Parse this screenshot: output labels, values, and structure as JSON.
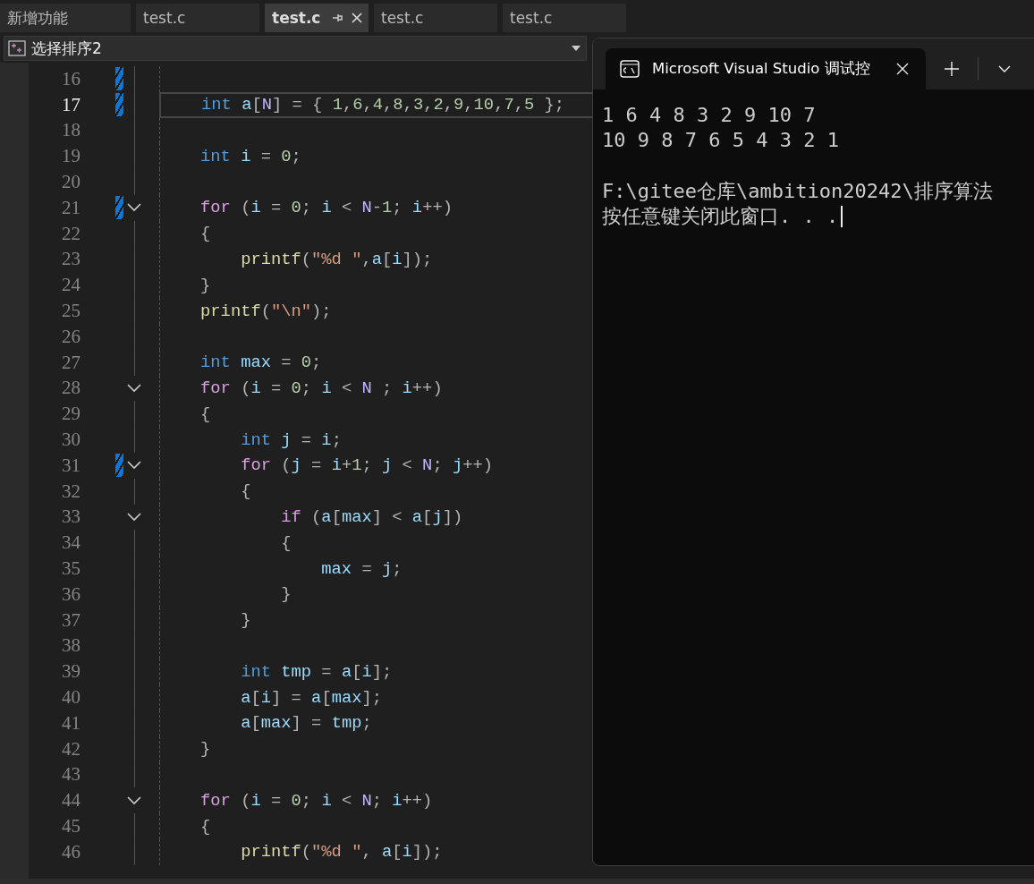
{
  "editor_tabs": [
    {
      "label": "新增功能",
      "selected": false,
      "pinnable": false
    },
    {
      "label": "test.c",
      "selected": false,
      "pinnable": false
    },
    {
      "label": "test.c",
      "selected": true,
      "pinnable": true
    },
    {
      "label": "test.c",
      "selected": false,
      "pinnable": false
    },
    {
      "label": "test.c",
      "selected": false,
      "pinnable": false
    }
  ],
  "navigation_bar": {
    "scope": "选择排序2"
  },
  "code_lines": [
    {
      "number": "16",
      "modified": true,
      "foldable": false,
      "current": false
    },
    {
      "number": "17",
      "modified": true,
      "foldable": false,
      "current": true,
      "tokens": [
        {
          "kind": "type",
          "text": "    int"
        },
        {
          "kind": "variable",
          "text": " a"
        },
        {
          "kind": "punct",
          "text": "["
        },
        {
          "kind": "macro",
          "text": "N"
        },
        {
          "kind": "punct",
          "text": "] = { "
        },
        {
          "kind": "number",
          "text": "1"
        },
        {
          "kind": "punct",
          "text": ","
        },
        {
          "kind": "number",
          "text": "6"
        },
        {
          "kind": "punct",
          "text": ","
        },
        {
          "kind": "number",
          "text": "4"
        },
        {
          "kind": "punct",
          "text": ","
        },
        {
          "kind": "number",
          "text": "8"
        },
        {
          "kind": "punct",
          "text": ","
        },
        {
          "kind": "number",
          "text": "3"
        },
        {
          "kind": "punct",
          "text": ","
        },
        {
          "kind": "number",
          "text": "2"
        },
        {
          "kind": "punct",
          "text": ","
        },
        {
          "kind": "number",
          "text": "9"
        },
        {
          "kind": "punct",
          "text": ","
        },
        {
          "kind": "number",
          "text": "10"
        },
        {
          "kind": "punct",
          "text": ","
        },
        {
          "kind": "number",
          "text": "7"
        },
        {
          "kind": "punct",
          "text": ","
        },
        {
          "kind": "number",
          "text": "5"
        },
        {
          "kind": "punct",
          "text": " };"
        }
      ]
    },
    {
      "number": "18",
      "modified": false,
      "foldable": false,
      "current": false
    },
    {
      "number": "19",
      "modified": false,
      "foldable": false,
      "current": false,
      "tokens": [
        {
          "kind": "type",
          "text": "    int"
        },
        {
          "kind": "variable",
          "text": " i"
        },
        {
          "kind": "punct",
          "text": " = "
        },
        {
          "kind": "number",
          "text": "0"
        },
        {
          "kind": "punct",
          "text": ";"
        }
      ]
    },
    {
      "number": "20",
      "modified": false,
      "foldable": false,
      "current": false
    },
    {
      "number": "21",
      "modified": true,
      "foldable": true,
      "current": false,
      "tokens": [
        {
          "kind": "keyword",
          "text": "    for"
        },
        {
          "kind": "punct",
          "text": " ("
        },
        {
          "kind": "variable",
          "text": "i"
        },
        {
          "kind": "punct",
          "text": " = "
        },
        {
          "kind": "number",
          "text": "0"
        },
        {
          "kind": "punct",
          "text": "; "
        },
        {
          "kind": "variable",
          "text": "i"
        },
        {
          "kind": "punct",
          "text": " < "
        },
        {
          "kind": "macro",
          "text": "N"
        },
        {
          "kind": "punct",
          "text": "-"
        },
        {
          "kind": "number",
          "text": "1"
        },
        {
          "kind": "punct",
          "text": "; "
        },
        {
          "kind": "variable",
          "text": "i"
        },
        {
          "kind": "punct",
          "text": "++)"
        }
      ]
    },
    {
      "number": "22",
      "modified": false,
      "foldable": false,
      "current": false,
      "tokens": [
        {
          "kind": "punct",
          "text": "    {"
        }
      ]
    },
    {
      "number": "23",
      "modified": false,
      "foldable": false,
      "current": false,
      "tokens": [
        {
          "kind": "function",
          "text": "        printf"
        },
        {
          "kind": "punct",
          "text": "("
        },
        {
          "kind": "string",
          "text": "\"%d \""
        },
        {
          "kind": "punct",
          "text": ","
        },
        {
          "kind": "variable",
          "text": "a"
        },
        {
          "kind": "punct",
          "text": "["
        },
        {
          "kind": "variable",
          "text": "i"
        },
        {
          "kind": "punct",
          "text": "]);"
        }
      ]
    },
    {
      "number": "24",
      "modified": false,
      "foldable": false,
      "current": false,
      "tokens": [
        {
          "kind": "punct",
          "text": "    }"
        }
      ]
    },
    {
      "number": "25",
      "modified": false,
      "foldable": false,
      "current": false,
      "tokens": [
        {
          "kind": "function",
          "text": "    printf"
        },
        {
          "kind": "punct",
          "text": "("
        },
        {
          "kind": "string",
          "text": "\"\\n\""
        },
        {
          "kind": "punct",
          "text": ");"
        }
      ]
    },
    {
      "number": "26",
      "modified": false,
      "foldable": false,
      "current": false
    },
    {
      "number": "27",
      "modified": false,
      "foldable": false,
      "current": false,
      "tokens": [
        {
          "kind": "type",
          "text": "    int"
        },
        {
          "kind": "variable",
          "text": " max"
        },
        {
          "kind": "punct",
          "text": " = "
        },
        {
          "kind": "number",
          "text": "0"
        },
        {
          "kind": "punct",
          "text": ";"
        }
      ]
    },
    {
      "number": "28",
      "modified": false,
      "foldable": true,
      "current": false,
      "tokens": [
        {
          "kind": "keyword",
          "text": "    for"
        },
        {
          "kind": "punct",
          "text": " ("
        },
        {
          "kind": "variable",
          "text": "i"
        },
        {
          "kind": "punct",
          "text": " = "
        },
        {
          "kind": "number",
          "text": "0"
        },
        {
          "kind": "punct",
          "text": "; "
        },
        {
          "kind": "variable",
          "text": "i"
        },
        {
          "kind": "punct",
          "text": " < "
        },
        {
          "kind": "macro",
          "text": "N"
        },
        {
          "kind": "punct",
          "text": " ; "
        },
        {
          "kind": "variable",
          "text": "i"
        },
        {
          "kind": "punct",
          "text": "++)"
        }
      ]
    },
    {
      "number": "29",
      "modified": false,
      "foldable": false,
      "current": false,
      "tokens": [
        {
          "kind": "punct",
          "text": "    {"
        }
      ]
    },
    {
      "number": "30",
      "modified": false,
      "foldable": false,
      "current": false,
      "tokens": [
        {
          "kind": "type",
          "text": "        int"
        },
        {
          "kind": "variable",
          "text": " j"
        },
        {
          "kind": "punct",
          "text": " = "
        },
        {
          "kind": "variable",
          "text": "i"
        },
        {
          "kind": "punct",
          "text": ";"
        }
      ]
    },
    {
      "number": "31",
      "modified": true,
      "foldable": true,
      "current": false,
      "tokens": [
        {
          "kind": "keyword",
          "text": "        for"
        },
        {
          "kind": "punct",
          "text": " ("
        },
        {
          "kind": "variable",
          "text": "j"
        },
        {
          "kind": "punct",
          "text": " = "
        },
        {
          "kind": "variable",
          "text": "i"
        },
        {
          "kind": "punct",
          "text": "+"
        },
        {
          "kind": "number",
          "text": "1"
        },
        {
          "kind": "punct",
          "text": "; "
        },
        {
          "kind": "variable",
          "text": "j"
        },
        {
          "kind": "punct",
          "text": " < "
        },
        {
          "kind": "macro",
          "text": "N"
        },
        {
          "kind": "punct",
          "text": "; "
        },
        {
          "kind": "variable",
          "text": "j"
        },
        {
          "kind": "punct",
          "text": "++)"
        }
      ]
    },
    {
      "number": "32",
      "modified": false,
      "foldable": false,
      "current": false,
      "tokens": [
        {
          "kind": "punct",
          "text": "        {"
        }
      ]
    },
    {
      "number": "33",
      "modified": false,
      "foldable": true,
      "current": false,
      "tokens": [
        {
          "kind": "keyword",
          "text": "            if"
        },
        {
          "kind": "punct",
          "text": " ("
        },
        {
          "kind": "variable",
          "text": "a"
        },
        {
          "kind": "punct",
          "text": "["
        },
        {
          "kind": "variable",
          "text": "max"
        },
        {
          "kind": "punct",
          "text": "] < "
        },
        {
          "kind": "variable",
          "text": "a"
        },
        {
          "kind": "punct",
          "text": "["
        },
        {
          "kind": "variable",
          "text": "j"
        },
        {
          "kind": "punct",
          "text": "])"
        }
      ]
    },
    {
      "number": "34",
      "modified": false,
      "foldable": false,
      "current": false,
      "tokens": [
        {
          "kind": "punct",
          "text": "            {"
        }
      ]
    },
    {
      "number": "35",
      "modified": false,
      "foldable": false,
      "current": false,
      "tokens": [
        {
          "kind": "variable",
          "text": "                max"
        },
        {
          "kind": "punct",
          "text": " = "
        },
        {
          "kind": "variable",
          "text": "j"
        },
        {
          "kind": "punct",
          "text": ";"
        }
      ]
    },
    {
      "number": "36",
      "modified": false,
      "foldable": false,
      "current": false,
      "tokens": [
        {
          "kind": "punct",
          "text": "            }"
        }
      ]
    },
    {
      "number": "37",
      "modified": false,
      "foldable": false,
      "current": false,
      "tokens": [
        {
          "kind": "punct",
          "text": "        }"
        }
      ]
    },
    {
      "number": "38",
      "modified": false,
      "foldable": false,
      "current": false
    },
    {
      "number": "39",
      "modified": false,
      "foldable": false,
      "current": false,
      "tokens": [
        {
          "kind": "type",
          "text": "        int"
        },
        {
          "kind": "variable",
          "text": " tmp"
        },
        {
          "kind": "punct",
          "text": " = "
        },
        {
          "kind": "variable",
          "text": "a"
        },
        {
          "kind": "punct",
          "text": "["
        },
        {
          "kind": "variable",
          "text": "i"
        },
        {
          "kind": "punct",
          "text": "];"
        }
      ]
    },
    {
      "number": "40",
      "modified": false,
      "foldable": false,
      "current": false,
      "tokens": [
        {
          "kind": "variable",
          "text": "        a"
        },
        {
          "kind": "punct",
          "text": "["
        },
        {
          "kind": "variable",
          "text": "i"
        },
        {
          "kind": "punct",
          "text": "] = "
        },
        {
          "kind": "variable",
          "text": "a"
        },
        {
          "kind": "punct",
          "text": "["
        },
        {
          "kind": "variable",
          "text": "max"
        },
        {
          "kind": "punct",
          "text": "];"
        }
      ]
    },
    {
      "number": "41",
      "modified": false,
      "foldable": false,
      "current": false,
      "tokens": [
        {
          "kind": "variable",
          "text": "        a"
        },
        {
          "kind": "punct",
          "text": "["
        },
        {
          "kind": "variable",
          "text": "max"
        },
        {
          "kind": "punct",
          "text": "] = "
        },
        {
          "kind": "variable",
          "text": "tmp"
        },
        {
          "kind": "punct",
          "text": ";"
        }
      ]
    },
    {
      "number": "42",
      "modified": false,
      "foldable": false,
      "current": false,
      "tokens": [
        {
          "kind": "punct",
          "text": "    }"
        }
      ]
    },
    {
      "number": "43",
      "modified": false,
      "foldable": false,
      "current": false
    },
    {
      "number": "44",
      "modified": false,
      "foldable": true,
      "current": false,
      "tokens": [
        {
          "kind": "keyword",
          "text": "    for"
        },
        {
          "kind": "punct",
          "text": " ("
        },
        {
          "kind": "variable",
          "text": "i"
        },
        {
          "kind": "punct",
          "text": " = "
        },
        {
          "kind": "number",
          "text": "0"
        },
        {
          "kind": "punct",
          "text": "; "
        },
        {
          "kind": "variable",
          "text": "i"
        },
        {
          "kind": "punct",
          "text": " < "
        },
        {
          "kind": "macro",
          "text": "N"
        },
        {
          "kind": "punct",
          "text": "; "
        },
        {
          "kind": "variable",
          "text": "i"
        },
        {
          "kind": "punct",
          "text": "++)"
        }
      ]
    },
    {
      "number": "45",
      "modified": false,
      "foldable": false,
      "current": false,
      "tokens": [
        {
          "kind": "punct",
          "text": "    {"
        }
      ]
    },
    {
      "number": "46",
      "modified": false,
      "foldable": false,
      "current": false,
      "tokens": [
        {
          "kind": "function",
          "text": "        printf"
        },
        {
          "kind": "punct",
          "text": "("
        },
        {
          "kind": "string",
          "text": "\"%d \""
        },
        {
          "kind": "punct",
          "text": ", "
        },
        {
          "kind": "variable",
          "text": "a"
        },
        {
          "kind": "punct",
          "text": "["
        },
        {
          "kind": "variable",
          "text": "i"
        },
        {
          "kind": "punct",
          "text": "]);"
        }
      ]
    }
  ],
  "console_window": {
    "tab_title": "Microsoft Visual Studio 调试控",
    "output_blocks": [
      {
        "lines": [
          {
            "text": "1 6 4 8 3 2 9 10 7",
            "cursor": false
          },
          {
            "text": "10 9 8 7 6 5 4 3 2 1",
            "cursor": false
          }
        ]
      },
      {
        "lines": [
          {
            "text": "F:\\gitee仓库\\ambition20242\\排序算法",
            "cursor": false
          },
          {
            "text": "按任意键关闭此窗口. . .",
            "cursor": true
          }
        ]
      }
    ]
  }
}
